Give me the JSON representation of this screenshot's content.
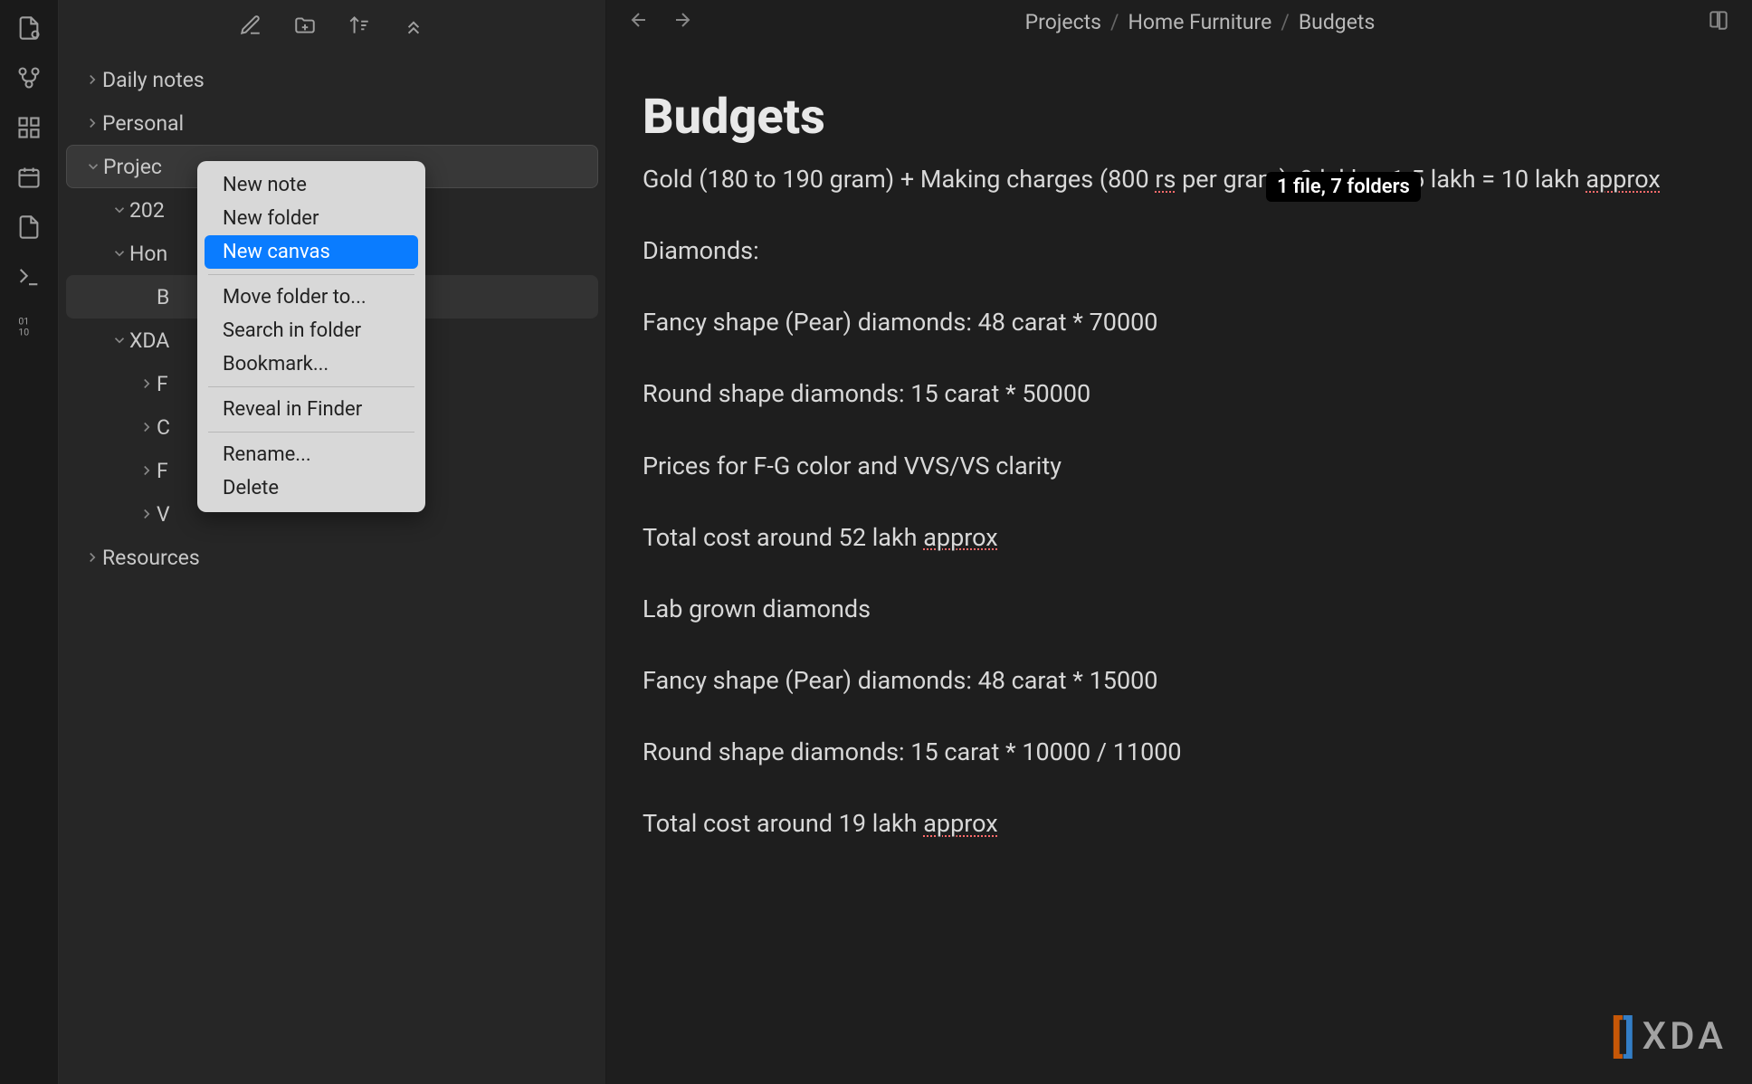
{
  "rail": {
    "icons": [
      "file-icon",
      "git-icon",
      "grid-icon",
      "calendar-icon",
      "document-icon",
      "terminal-icon",
      "binary-icon"
    ]
  },
  "toolbar": {
    "icons": [
      "new-note-icon",
      "new-folder-icon",
      "sort-icon",
      "close-icon"
    ]
  },
  "tree": {
    "items": [
      {
        "label": "Daily notes",
        "indent": 0,
        "chev": "right"
      },
      {
        "label": "Personal",
        "indent": 0,
        "chev": "right"
      },
      {
        "label": "Projec",
        "indent": 0,
        "chev": "down",
        "active": true
      },
      {
        "label": "202",
        "indent": 1,
        "chev": "down"
      },
      {
        "label": "Hon",
        "indent": 1,
        "chev": "down"
      },
      {
        "label": "B",
        "indent": 2,
        "chev": "",
        "selected": true
      },
      {
        "label": "XDA",
        "indent": 1,
        "chev": "down"
      },
      {
        "label": "F",
        "indent": 2,
        "chev": "right"
      },
      {
        "label": "C",
        "indent": 2,
        "chev": "right"
      },
      {
        "label": "F",
        "indent": 2,
        "chev": "right"
      },
      {
        "label": "V",
        "indent": 2,
        "chev": "right"
      },
      {
        "label": "Resources",
        "indent": 0,
        "chev": "right"
      }
    ]
  },
  "context_menu": {
    "items": [
      {
        "label": "New note"
      },
      {
        "label": "New folder"
      },
      {
        "label": "New canvas",
        "highlighted": true
      },
      {
        "sep": true
      },
      {
        "label": "Move folder to..."
      },
      {
        "label": "Search in folder"
      },
      {
        "label": "Bookmark..."
      },
      {
        "sep": true
      },
      {
        "label": "Reveal in Finder"
      },
      {
        "sep": true
      },
      {
        "label": "Rename..."
      },
      {
        "label": "Delete"
      }
    ]
  },
  "breadcrumb": {
    "parts": [
      "Projects",
      "Home Furniture",
      "Budgets"
    ]
  },
  "note": {
    "title": "Budgets",
    "tooltip": "1 file, 7 folders",
    "paragraphs": [
      "Gold (180 to 190 gram) + Making charges (800 rs per gram): 9 lakh + 1.5 lakh = 10 lakh approx",
      "Diamonds:",
      "Fancy shape (Pear) diamonds: 48 carat * 70000",
      "Round shape diamonds: 15 carat * 50000",
      "Prices for F-G color and VVS/VS clarity",
      "Total cost around 52 lakh approx",
      "Lab grown diamonds",
      "Fancy shape (Pear) diamonds: 48 carat * 15000",
      "Round shape diamonds: 15 carat * 10000 / 11000",
      "Total cost around 19 lakh approx"
    ],
    "spellcheck_words": [
      "rs",
      "approx"
    ]
  },
  "watermark": {
    "text": "XDA"
  }
}
